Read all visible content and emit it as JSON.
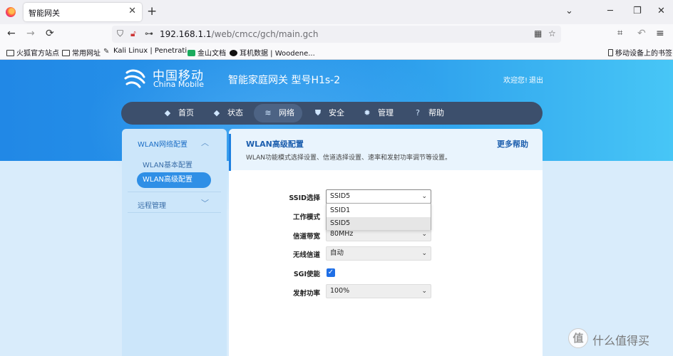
{
  "browser": {
    "tab_title": "智能网关",
    "tab_close": "✕",
    "new_tab": "+",
    "win_minimize": "─",
    "win_restore": "❐",
    "win_close": "✕",
    "win_tabs_menu": "⌄",
    "url_host": "192.168.1.1",
    "url_path": "/web/cmcc/gch/main.gch",
    "back": "←",
    "forward": "→",
    "reload": "⟳",
    "bookmarks": [
      {
        "label": "火狐官方站点",
        "icon": "folder-icon"
      },
      {
        "label": "常用网址",
        "icon": "folder-icon"
      },
      {
        "label": "Kali Linux | Penetrati...",
        "icon": "kali-icon"
      },
      {
        "label": "金山文档",
        "icon": "doc-icon"
      },
      {
        "label": "耳机数据 | Woodene...",
        "icon": "github-icon"
      }
    ],
    "mobile_bookmarks": "移动设备上的书签"
  },
  "header": {
    "brand_cn": "中国移动",
    "brand_en": "China Mobile",
    "gateway_title": "智能家庭网关 型号H1s-2",
    "welcome": "欢迎您!",
    "logout": "退出"
  },
  "nav": {
    "items": [
      {
        "label": "首页",
        "icon": "layers-icon"
      },
      {
        "label": "状态",
        "icon": "layers-icon"
      },
      {
        "label": "网络",
        "icon": "wifi-icon",
        "active": true
      },
      {
        "label": "安全",
        "icon": "shield-icon"
      },
      {
        "label": "管理",
        "icon": "gear-icon"
      },
      {
        "label": "帮助",
        "icon": "help-icon"
      }
    ]
  },
  "sidebar": {
    "group1": "WLAN网络配置",
    "item1": "WLAN基本配置",
    "item2": "WLAN高级配置",
    "group2": "远程管理"
  },
  "content": {
    "title": "WLAN高级配置",
    "more_help": "更多帮助",
    "description": "WLAN功能模式选择设置、信道选择设置、速率和发射功率调节等设置。",
    "fields": {
      "ssid_label": "SSID选择",
      "ssid_value": "SSID5",
      "mode_label": "工作模式",
      "bandwidth_label": "信道带宽",
      "bandwidth_value": "80MHz",
      "channel_label": "无线信道",
      "channel_value": "自动",
      "sgi_label": "SGI使能",
      "sgi_checked": true,
      "power_label": "发射功率",
      "power_value": "100%"
    },
    "ssid_options": [
      "SSID1",
      "SSID5"
    ]
  },
  "watermark": {
    "badge": "值",
    "text": "什么值得买"
  },
  "colors": {
    "banner_start": "#2188e6",
    "banner_end": "#47c6f6",
    "nav_bg": "#3c4f6c",
    "accent": "#2f8fe6"
  }
}
